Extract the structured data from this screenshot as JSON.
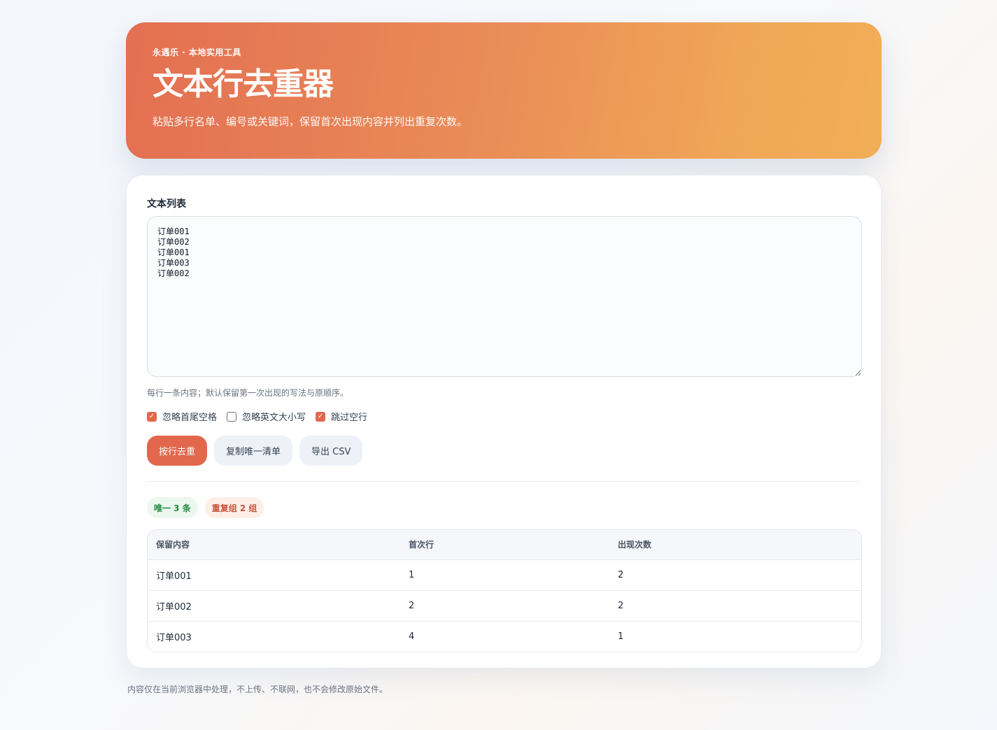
{
  "hero": {
    "eyebrow": "永遇乐 · 本地实用工具",
    "title": "文本行去重器",
    "subtitle": "粘贴多行名单、编号或关键词，保留首次出现内容并列出重复次数。"
  },
  "input": {
    "label": "文本列表",
    "value": "订单001\n订单002\n订单001\n订单003\n订单002",
    "hint": "每行一条内容；默认保留第一次出现的写法与原顺序。"
  },
  "options": [
    {
      "label": "忽略首尾空格",
      "checked": true
    },
    {
      "label": "忽略英文大小写",
      "checked": false
    },
    {
      "label": "跳过空行",
      "checked": true
    }
  ],
  "buttons": {
    "dedupe": "按行去重",
    "copy": "复制唯一清单",
    "export": "导出 CSV"
  },
  "badges": {
    "unique": "唯一 3 条",
    "duplicates": "重复组 2 组"
  },
  "table": {
    "headers": [
      "保留内容",
      "首次行",
      "出现次数"
    ],
    "rows": [
      [
        "订单001",
        "1",
        "2"
      ],
      [
        "订单002",
        "2",
        "2"
      ],
      [
        "订单003",
        "4",
        "1"
      ]
    ]
  },
  "footer": "内容仅在当前浏览器中处理，不上传、不联网，也不会修改原始文件。",
  "colors": {
    "accent": "#e2674c",
    "hero_start": "#e36f52",
    "hero_end": "#f2ae57"
  }
}
